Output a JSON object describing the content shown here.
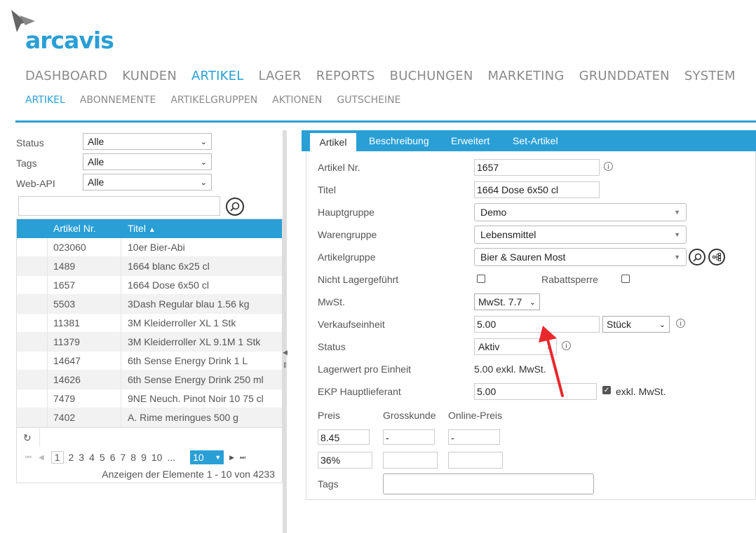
{
  "logo": {
    "text": "arcavis"
  },
  "main_nav": [
    "DASHBOARD",
    "KUNDEN",
    "ARTIKEL",
    "LAGER",
    "REPORTS",
    "BUCHUNGEN",
    "MARKETING",
    "GRUNDDATEN",
    "SYSTEM"
  ],
  "main_nav_active": "ARTIKEL",
  "sub_nav": [
    "ARTIKEL",
    "ABONNEMENTE",
    "ARTIKELGRUPPEN",
    "AKTIONEN",
    "GUTSCHEINE"
  ],
  "filters": {
    "status_label": "Status",
    "status_value": "Alle",
    "tags_label": "Tags",
    "tags_value": "Alle",
    "webapi_label": "Web-API",
    "webapi_value": "Alle"
  },
  "grid": {
    "col_nr": "Artikel Nr.",
    "col_title": "Titel",
    "rows": [
      {
        "nr": "023060",
        "title": "10er Bier-Abi"
      },
      {
        "nr": "1489",
        "title": "1664 blanc 6x25 cl"
      },
      {
        "nr": "1657",
        "title": "1664 Dose 6x50 cl"
      },
      {
        "nr": "5503",
        "title": "3Dash Regular blau 1.56 kg"
      },
      {
        "nr": "11381",
        "title": "3M Kleiderroller XL 1 Stk"
      },
      {
        "nr": "11379",
        "title": "3M Kleiderroller XL 9.1M 1 Stk"
      },
      {
        "nr": "14647",
        "title": "6th Sense Energy Drink 1 L"
      },
      {
        "nr": "14626",
        "title": "6th Sense Energy Drink 250 ml"
      },
      {
        "nr": "7479",
        "title": "9NE Neuch. Pinot Noir 10 75 cl"
      },
      {
        "nr": "7402",
        "title": "A. Rime meringues 500 g"
      }
    ],
    "pages": [
      "1",
      "2",
      "3",
      "4",
      "5",
      "6",
      "7",
      "8",
      "9",
      "10",
      "..."
    ],
    "page_size": "10",
    "summary": "Anzeigen der Elemente 1 - 10 von 4233"
  },
  "tabs": [
    "Artikel",
    "Beschreibung",
    "Erweitert",
    "Set-Artikel"
  ],
  "form": {
    "artikel_nr_label": "Artikel Nr.",
    "artikel_nr": "1657",
    "titel_label": "Titel",
    "titel": "1664 Dose 6x50 cl",
    "hauptgruppe_label": "Hauptgruppe",
    "hauptgruppe": "Demo",
    "warengruppe_label": "Warengruppe",
    "warengruppe": "Lebensmittel",
    "artikelgruppe_label": "Artikelgruppe",
    "artikelgruppe": "Bier & Sauren Most",
    "nicht_lager_label": "Nicht Lagergeführt",
    "rabattsperre_label": "Rabattsperre",
    "mwst_label": "MwSt.",
    "mwst": "MwSt. 7.7",
    "verkaufseinheit_label": "Verkaufseinheit",
    "verkaufseinheit": "5.00",
    "einheit": "Stück",
    "status_label": "Status",
    "status": "Aktiv",
    "lagerwert_label": "Lagerwert pro Einheit",
    "lagerwert": "5.00 exkl. MwSt.",
    "ekp_label": "EKP Hauptlieferant",
    "ekp": "5.00",
    "exkl_label": "exkl. MwSt.",
    "preis_label": "Preis",
    "grosskunde_label": "Grosskunde",
    "online_label": "Online-Preis",
    "preis": "8.45",
    "grosskunde": "-",
    "online": "-",
    "marge": "36%",
    "tags_label": "Tags"
  },
  "colors": {
    "accent": "#2a9fd6",
    "arrow": "#e8282b"
  }
}
